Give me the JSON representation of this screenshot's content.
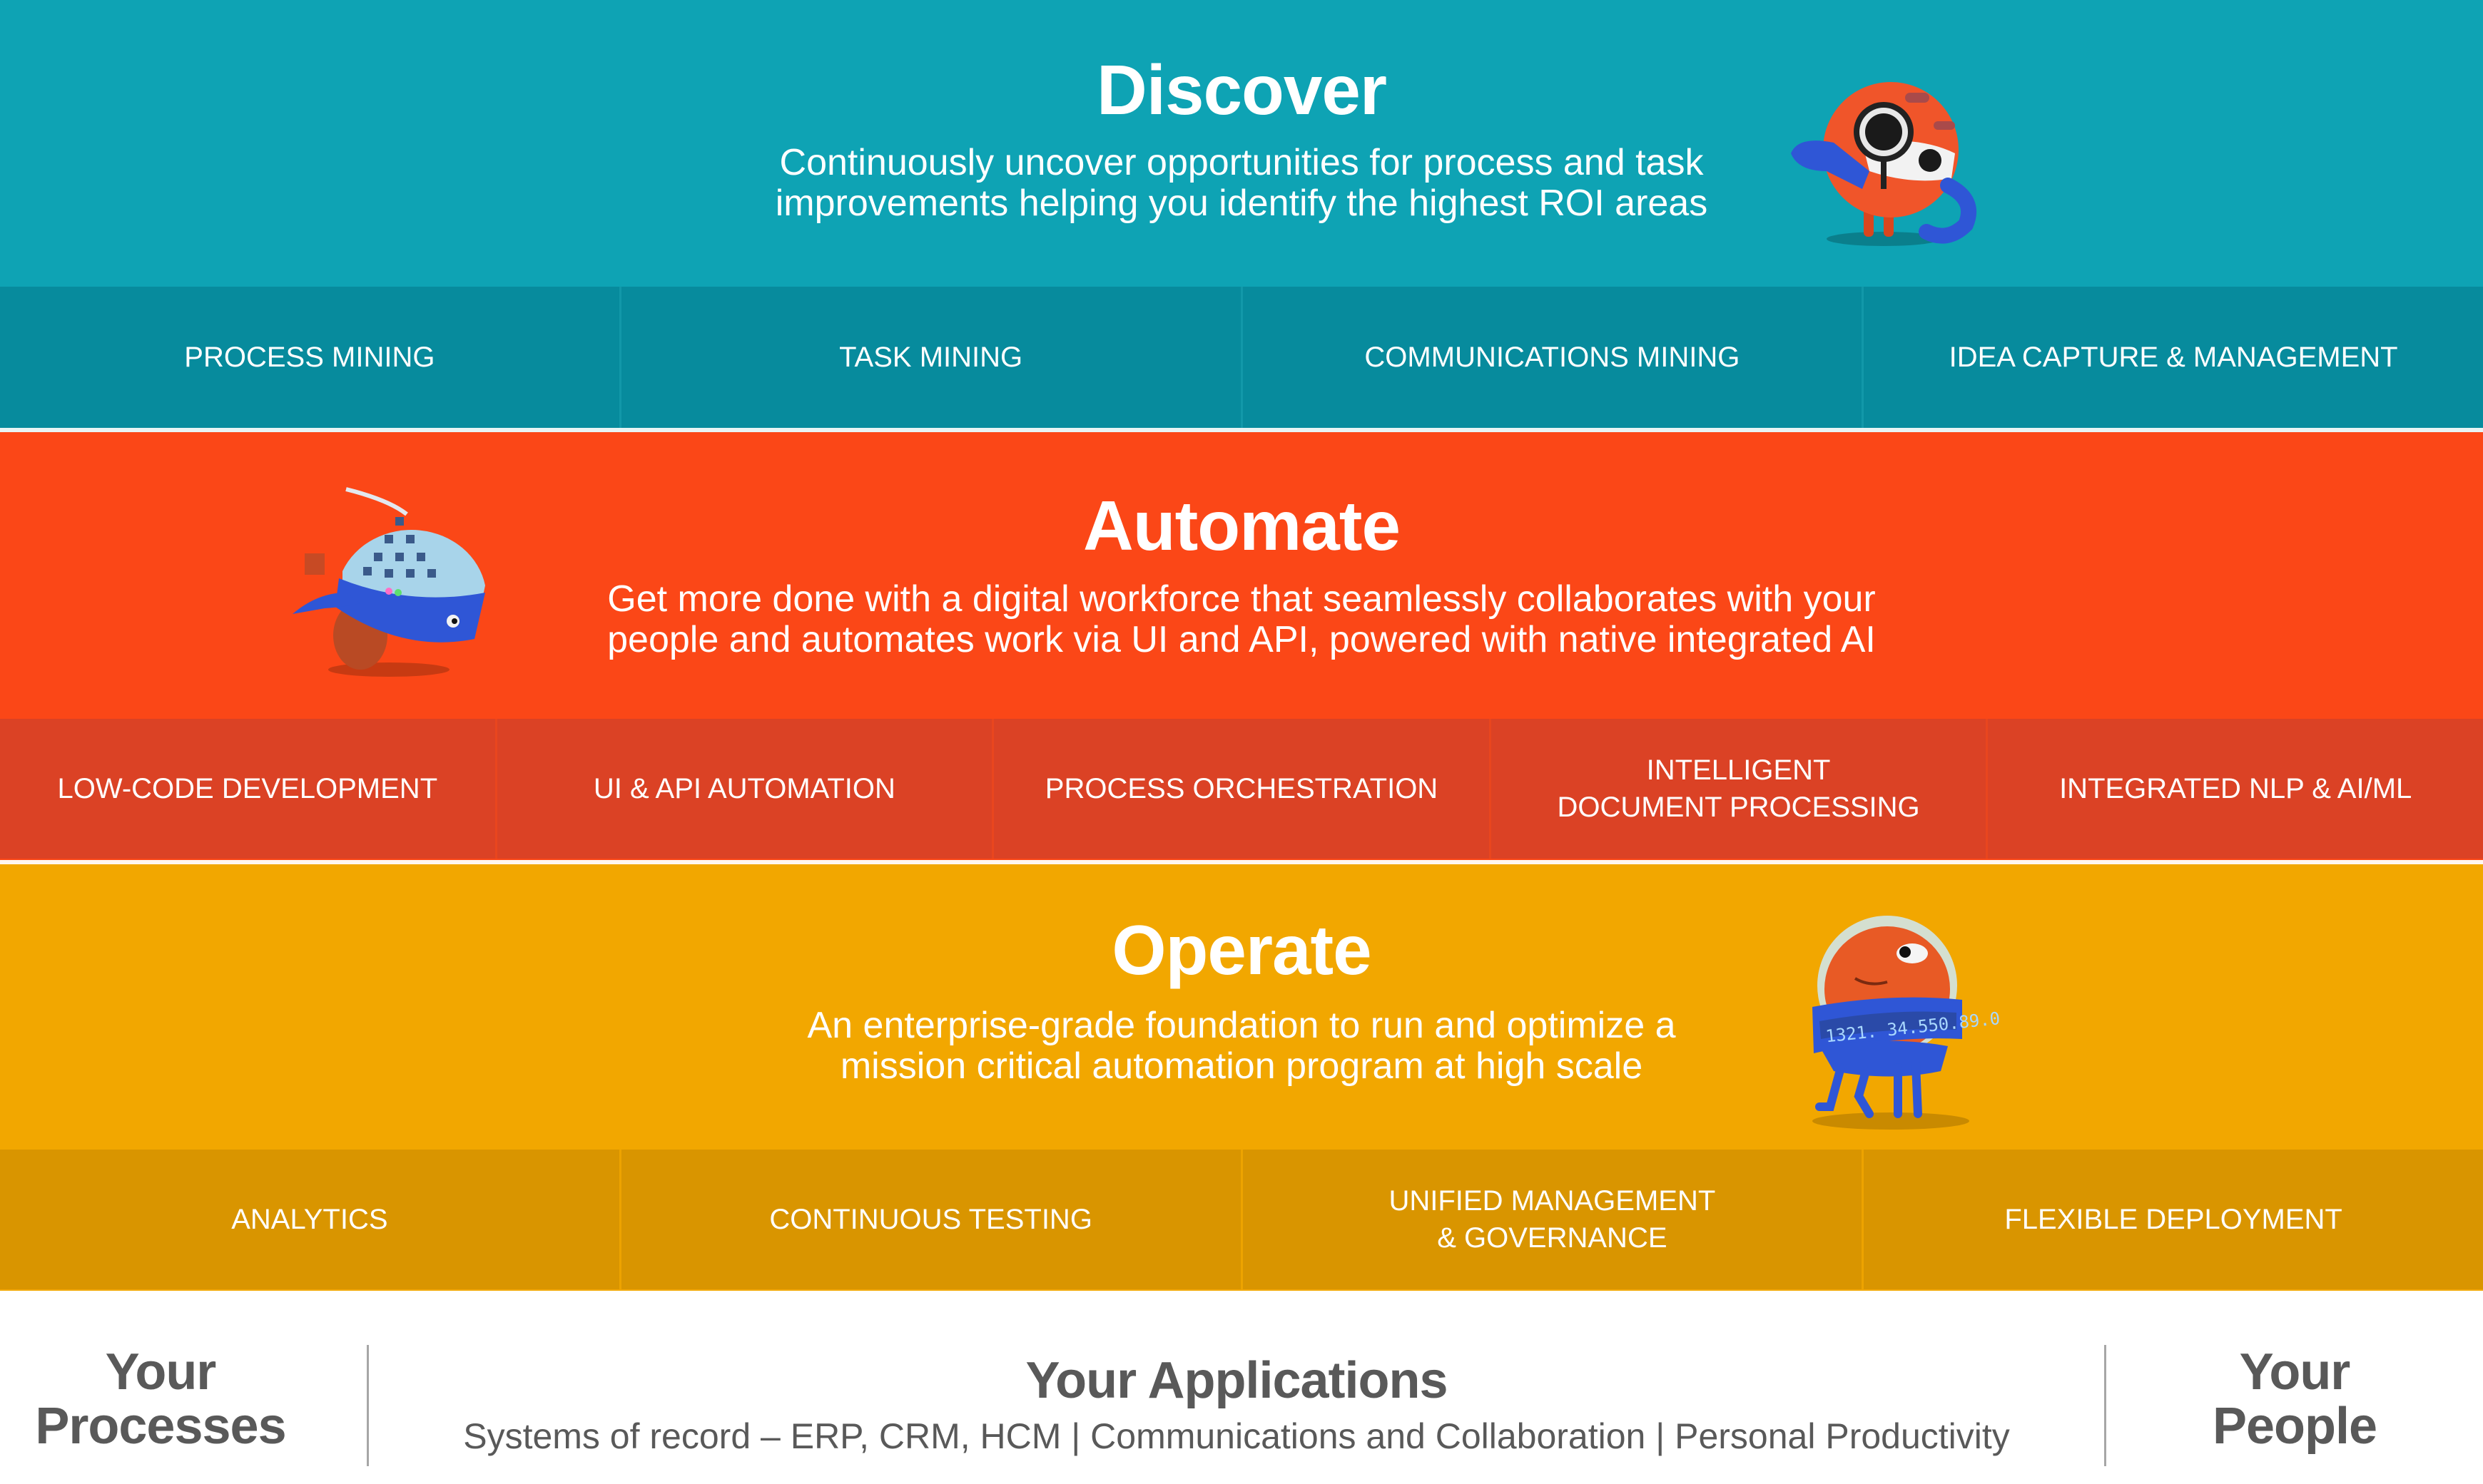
{
  "sections": [
    {
      "id": "discover",
      "title": "Discover",
      "description_lines": [
        "Continuously uncover opportunities for process and task",
        "improvements helping you identify the highest ROI areas"
      ],
      "mascot": "magnifying-glass-robot-mascot",
      "color": "#0ea3b4",
      "tile_color": "#078b9d",
      "tiles": [
        "PROCESS MINING",
        "TASK MINING",
        "COMMUNICATIONS MINING",
        "IDEA CAPTURE & MANAGEMENT"
      ]
    },
    {
      "id": "automate",
      "title": "Automate",
      "description_lines": [
        "Get more done with a digital workforce that seamlessly collaborates with your",
        "people and automates work via UI and API, powered with native integrated AI"
      ],
      "mascot": "dome-network-robot-mascot",
      "color": "#fb4717",
      "tile_color": "#db4225",
      "tiles": [
        "LOW-CODE DEVELOPMENT",
        "UI & API AUTOMATION",
        "PROCESS ORCHESTRATION",
        "INTELLIGENT\nDOCUMENT PROCESSING",
        "INTEGRATED NLP & AI/ML"
      ]
    },
    {
      "id": "operate",
      "title": "Operate",
      "description_lines": [
        "An enterprise-grade foundation to run and optimize a",
        "mission critical automation program at high scale"
      ],
      "mascot": "ticker-band-robot-mascot",
      "mascot_ticker_text": "1321. 34.550.89.0",
      "color": "#f2a700",
      "tile_color": "#d99500",
      "tiles": [
        "ANALYTICS",
        "CONTINUOUS TESTING",
        "UNIFIED MANAGEMENT\n& GOVERNANCE",
        "FLEXIBLE DEPLOYMENT"
      ]
    }
  ],
  "footer": {
    "left": {
      "line1": "Your",
      "line2": "Processes"
    },
    "center": {
      "title": "Your Applications",
      "subtitle": "Systems of record – ERP, CRM, HCM | Communications and Collaboration | Personal Productivity"
    },
    "right": {
      "line1": "Your",
      "line2": "People"
    },
    "text_color": "#595959"
  }
}
